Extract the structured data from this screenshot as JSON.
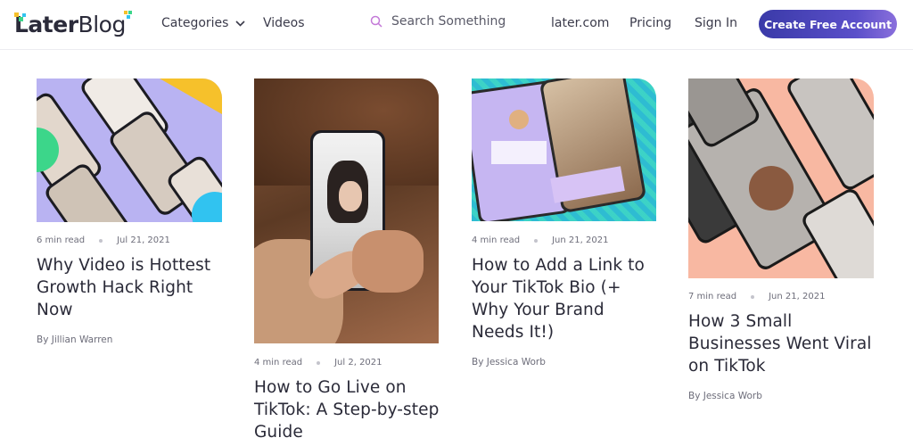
{
  "header": {
    "logo_bold": "Later",
    "logo_light": "Blog",
    "nav_categories": "Categories",
    "nav_videos": "Videos",
    "search_placeholder": "Search Something",
    "nav_later": "later.com",
    "nav_pricing": "Pricing",
    "nav_signin": "Sign In",
    "cta": "Create Free Account"
  },
  "colors": {
    "brand_purple": "#4d46b8",
    "accent_yellow": "#f6c12b",
    "accent_green": "#3cd68a",
    "accent_blue": "#31c3f0",
    "lavender": "#b7b1f0"
  },
  "articles": [
    {
      "read_time": "6 min read",
      "date": "Jul 21, 2021",
      "title": "Why Video is Hottest Growth Hack Right Now",
      "author": "By Jillian Warren",
      "thumb": "video-phones-collage"
    },
    {
      "read_time": "4 min read",
      "date": "Jul 2, 2021",
      "title": "How to Go Live on TikTok: A Step-by-step Guide",
      "author": "",
      "thumb": "hand-holding-phone-makeup"
    },
    {
      "read_time": "4 min read",
      "date": "Jun 21, 2021",
      "title": "How to Add a Link to Your TikTok Bio (+ Why Your Brand Needs It!)",
      "author": "By Jessica Worb",
      "thumb": "tiktok-profile-phones"
    },
    {
      "read_time": "7 min read",
      "date": "Jun 21, 2021",
      "title": "How 3 Small Businesses Went Viral on TikTok",
      "author": "By Jessica Worb",
      "thumb": "peach-phones-grid"
    }
  ]
}
